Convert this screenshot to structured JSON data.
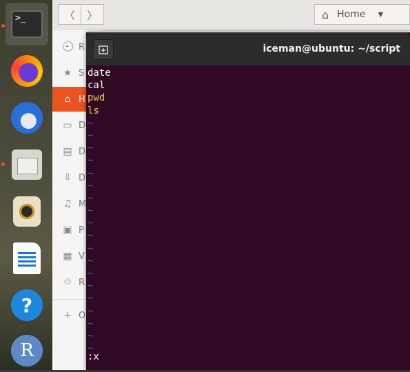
{
  "dock": {
    "apps": [
      {
        "name": "terminal",
        "glyph": ">_",
        "active": true,
        "running": true
      },
      {
        "name": "firefox",
        "active": false,
        "running": false
      },
      {
        "name": "thunderbird",
        "active": false,
        "running": false
      },
      {
        "name": "files",
        "active": false,
        "running": true
      },
      {
        "name": "rhythmbox",
        "active": false,
        "running": false
      },
      {
        "name": "libreoffice-writer",
        "active": false,
        "running": false
      },
      {
        "name": "help",
        "glyph": "?",
        "active": false,
        "running": false
      },
      {
        "name": "r",
        "glyph": "R",
        "active": false,
        "running": false
      }
    ]
  },
  "files": {
    "nav_back": "〈",
    "nav_forward": "〉",
    "path_label": "Home",
    "sidebar": [
      {
        "icon": "clock-icon",
        "glyph": "🕘",
        "label": "R"
      },
      {
        "icon": "star-icon",
        "glyph": "★",
        "label": "S"
      },
      {
        "icon": "home-icon",
        "glyph": "⌂",
        "label": "H",
        "active": true
      },
      {
        "icon": "desktop-icon",
        "glyph": "▭",
        "label": "D"
      },
      {
        "icon": "document-icon",
        "glyph": "▤",
        "label": "D"
      },
      {
        "icon": "download-icon",
        "glyph": "⇩",
        "label": "D"
      },
      {
        "icon": "music-icon",
        "glyph": "♫",
        "label": "M"
      },
      {
        "icon": "picture-icon",
        "glyph": "▣",
        "label": "P"
      },
      {
        "icon": "video-icon",
        "glyph": "▦",
        "label": "V"
      },
      {
        "icon": "trash-icon",
        "glyph": "♲",
        "label": "R"
      }
    ],
    "other_locations": {
      "glyph": "+",
      "label": "O"
    }
  },
  "terminal": {
    "title": "iceman@ubuntu: ~/script",
    "lines": [
      {
        "text": "date",
        "color": "#ffffff"
      },
      {
        "text": "cal",
        "color": "#ffffff"
      },
      {
        "text": "pwd",
        "color": "#f2c14e"
      },
      {
        "text": "ls",
        "color": "#f2c14e"
      }
    ],
    "tilde_count": 19,
    "tilde": "~",
    "command_line": ":x"
  },
  "colors": {
    "accent": "#e95420",
    "terminal_bg": "#300a24",
    "tilde": "#3465a4"
  }
}
